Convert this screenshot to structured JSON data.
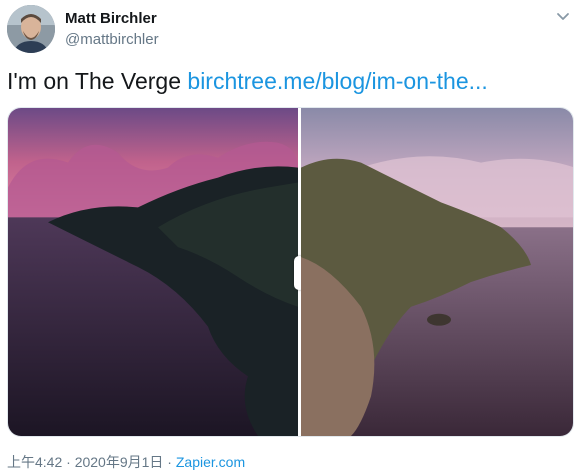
{
  "author": {
    "name": "Matt Birchler",
    "handle": "@mattbirchler"
  },
  "tweet": {
    "text": "I'm on The Verge ",
    "link": "birchtree.me/blog/im-on-the..."
  },
  "meta": {
    "time": "上午4:42 · 2020年9月1日 · ",
    "source": "Zapier.com"
  },
  "media": {
    "left_label": "dark-mode-island-photo",
    "right_label": "light-mode-island-photo"
  },
  "colors": {
    "link": "#1b95e0",
    "secondary": "#657786",
    "primary_text": "#14171a"
  }
}
